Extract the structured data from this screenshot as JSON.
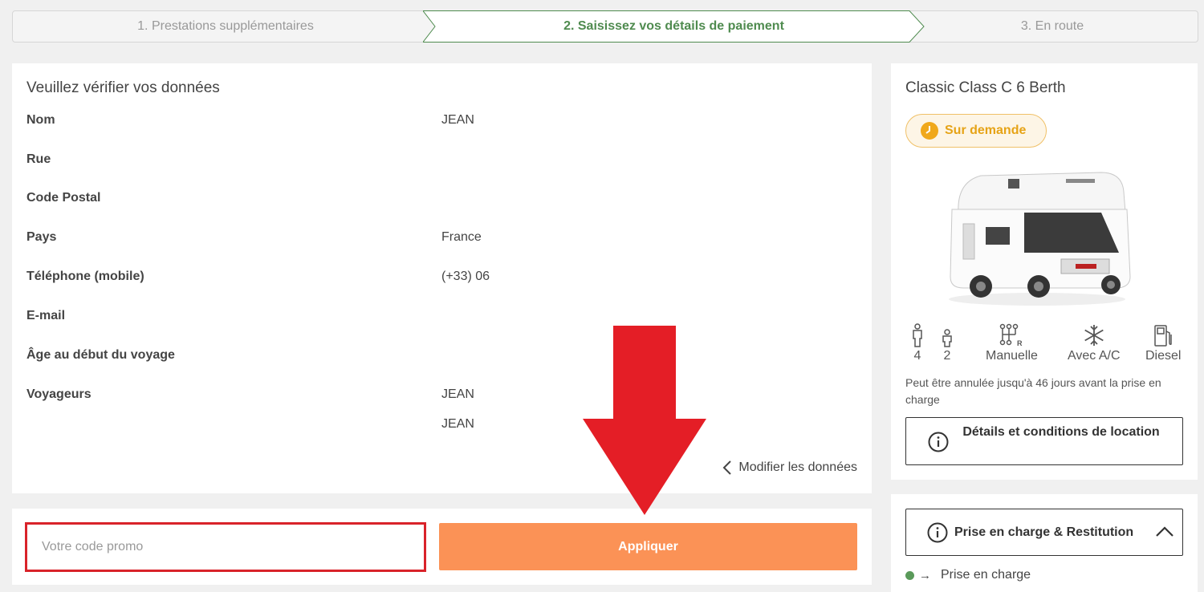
{
  "stepper": {
    "step1": "1. Prestations supplémentaires",
    "step2": "2. Saisissez vos détails de paiement",
    "step3": "3. En route"
  },
  "data_card": {
    "title": "Veuillez vérifier vos données",
    "rows": [
      {
        "label": "Nom",
        "value": "JEAN"
      },
      {
        "label": "Rue",
        "value": ""
      },
      {
        "label": "Code Postal",
        "value": ""
      },
      {
        "label": "Pays",
        "value": "France"
      },
      {
        "label": "Téléphone (mobile)",
        "value": "(+33) 06"
      },
      {
        "label": "E-mail",
        "value": ""
      },
      {
        "label": "Âge au début du voyage",
        "value": ""
      },
      {
        "label": "Voyageurs",
        "value": "JEAN"
      }
    ],
    "extra_traveler": "JEAN",
    "modify_label": "Modifier les données"
  },
  "promo": {
    "placeholder": "Votre code promo",
    "apply_label": "Appliquer"
  },
  "vehicle": {
    "title": "Classic Class C 6 Berth",
    "badge": "Sur demande",
    "features": [
      {
        "icon": "adult-icon",
        "label": "4"
      },
      {
        "icon": "child-icon",
        "label": "2"
      },
      {
        "icon": "gearbox-icon",
        "label": "Manuelle"
      },
      {
        "icon": "snowflake-icon",
        "label": "Avec A/C"
      },
      {
        "icon": "fuel-pump-icon",
        "label": "Diesel"
      }
    ],
    "cancel_text": "Peut être annulée jusqu'à 46 jours avant la prise en charge",
    "details_button": "Détails et conditions de location"
  },
  "pickup": {
    "button_label": "Prise en charge & Restitution",
    "row_label": "Prise en charge"
  },
  "colors": {
    "accent_green": "#4f8b4f",
    "apply_orange": "#fb9256",
    "highlight_red": "#d9232a",
    "badge_orange": "#f0a81b"
  }
}
